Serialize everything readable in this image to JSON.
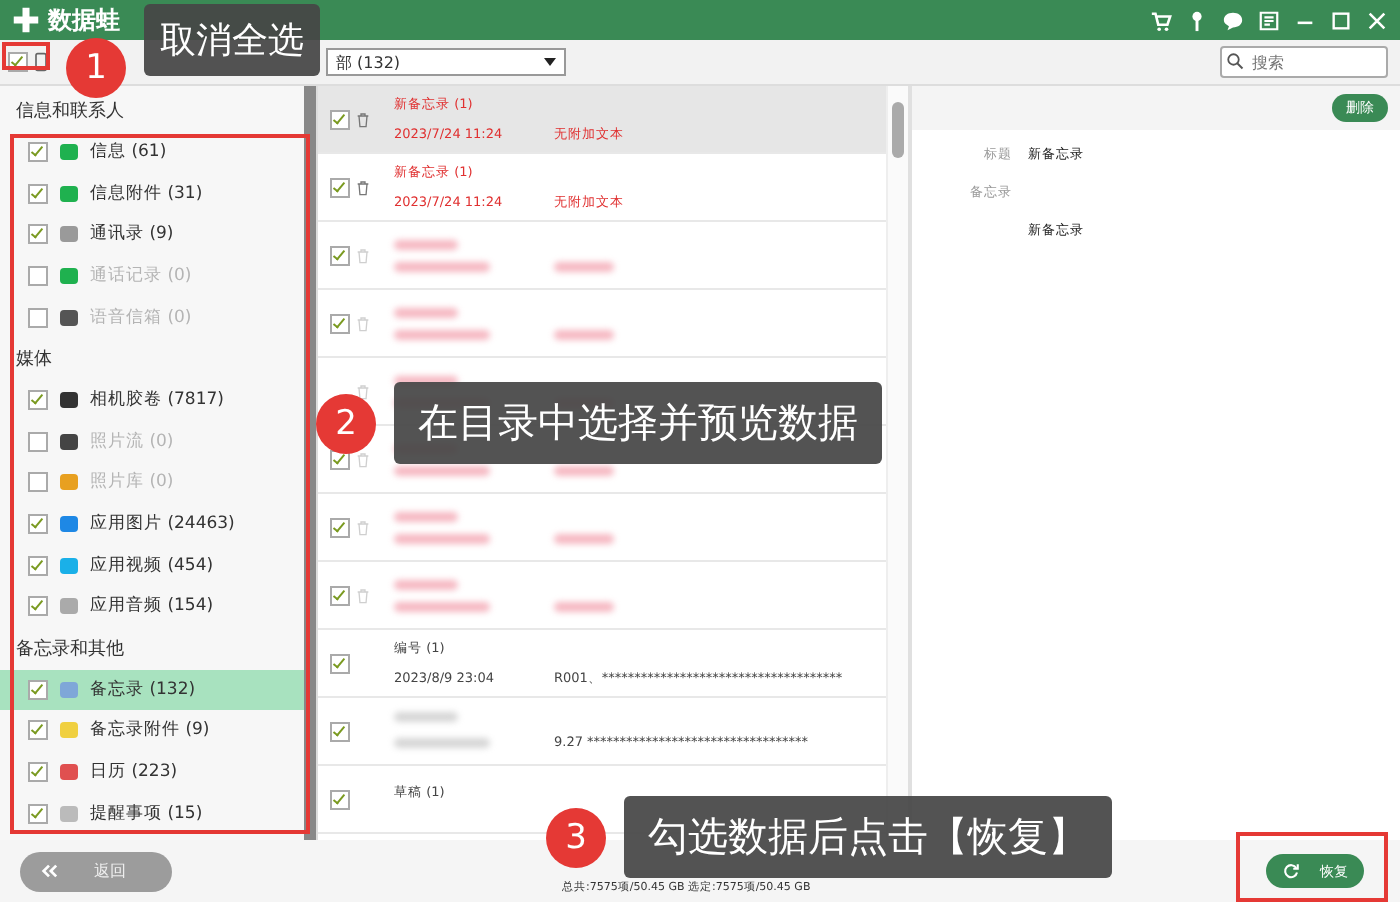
{
  "app": {
    "name": "数据蛙"
  },
  "toolbar": {
    "select_all_checked": true,
    "filter": "部 (132)",
    "search": {
      "placeholder": "搜索"
    }
  },
  "sidebar": {
    "groups": [
      {
        "title": "信息和联系人",
        "items": [
          {
            "label": "信息 (61)",
            "checked": true,
            "disabled": false,
            "selected": false,
            "color": "#1fb14f"
          },
          {
            "label": "信息附件 (31)",
            "checked": true,
            "disabled": false,
            "selected": false,
            "color": "#1fb14f"
          },
          {
            "label": "通讯录 (9)",
            "checked": true,
            "disabled": false,
            "selected": false,
            "color": "#9a9a9a"
          },
          {
            "label": "通话记录 (0)",
            "checked": false,
            "disabled": true,
            "selected": false,
            "color": "#1fb14f"
          },
          {
            "label": "语音信箱 (0)",
            "checked": false,
            "disabled": true,
            "selected": false,
            "color": "#555555"
          }
        ]
      },
      {
        "title": "媒体",
        "items": [
          {
            "label": "相机胶卷 (7817)",
            "checked": true,
            "disabled": false,
            "selected": false,
            "color": "#333333"
          },
          {
            "label": "照片流 (0)",
            "checked": false,
            "disabled": true,
            "selected": false,
            "color": "#444444"
          },
          {
            "label": "照片库 (0)",
            "checked": false,
            "disabled": true,
            "selected": false,
            "color": "#e8a020"
          },
          {
            "label": "应用图片 (24463)",
            "checked": true,
            "disabled": false,
            "selected": false,
            "color": "#1e88e5"
          },
          {
            "label": "应用视频 (454)",
            "checked": true,
            "disabled": false,
            "selected": false,
            "color": "#1ab0e8"
          },
          {
            "label": "应用音频 (154)",
            "checked": true,
            "disabled": false,
            "selected": false,
            "color": "#aaaaaa"
          }
        ]
      },
      {
        "title": "备忘录和其他",
        "items": [
          {
            "label": "备忘录 (132)",
            "checked": true,
            "disabled": false,
            "selected": true,
            "color": "#7fa7d8"
          },
          {
            "label": "备忘录附件 (9)",
            "checked": true,
            "disabled": false,
            "selected": false,
            "color": "#f0d040"
          },
          {
            "label": "日历 (223)",
            "checked": true,
            "disabled": false,
            "selected": false,
            "color": "#e05050"
          },
          {
            "label": "提醒事项 (15)",
            "checked": true,
            "disabled": false,
            "selected": false,
            "color": "#bbbbbb"
          }
        ]
      }
    ]
  },
  "records": [
    {
      "kind": "deleted",
      "checked": true,
      "selected": true,
      "title": "新备忘录 (1)",
      "date": "2023/7/24 11:24",
      "text": "无附加文本"
    },
    {
      "kind": "deleted",
      "checked": true,
      "selected": false,
      "title": "新备忘录 (1)",
      "date": "2023/7/24 11:24",
      "text": "无附加文本"
    },
    {
      "kind": "deleted",
      "checked": true,
      "selected": false,
      "blurred": true
    },
    {
      "kind": "deleted",
      "checked": true,
      "selected": false,
      "blurred": true
    },
    {
      "kind": "deleted",
      "selected": false,
      "blurred": true
    },
    {
      "kind": "deleted",
      "checked": true,
      "selected": false,
      "blurred": true
    },
    {
      "kind": "deleted",
      "checked": true,
      "selected": false,
      "blurred": true
    },
    {
      "kind": "deleted",
      "checked": true,
      "selected": false,
      "blurred": true
    },
    {
      "kind": "existing",
      "checked": true,
      "selected": false,
      "title": "编号 (1)",
      "date": "2023/8/9 23:04",
      "text": "R001、*************************************"
    },
    {
      "kind": "existing",
      "checked": true,
      "selected": false,
      "blurred": true,
      "text": "9.27 **********************************"
    },
    {
      "kind": "existing",
      "checked": true,
      "selected": false,
      "title": "草稿 (1)"
    }
  ],
  "detail": {
    "delete_button": "删除",
    "fields": [
      {
        "label": "标题",
        "value": "新备忘录"
      },
      {
        "label": "备忘录"
      }
    ],
    "body": "新备忘录"
  },
  "footer": {
    "back_button": "返回",
    "status": "总共:7575项/50.45 GB 选定:7575项/50.45 GB",
    "recover_button": "恢复"
  },
  "callouts": [
    {
      "number": "1",
      "text": "取消全选"
    },
    {
      "number": "2",
      "text": "在目录中选择并预览数据"
    },
    {
      "number": "3",
      "text": "勾选数据后点击【恢复】"
    }
  ]
}
